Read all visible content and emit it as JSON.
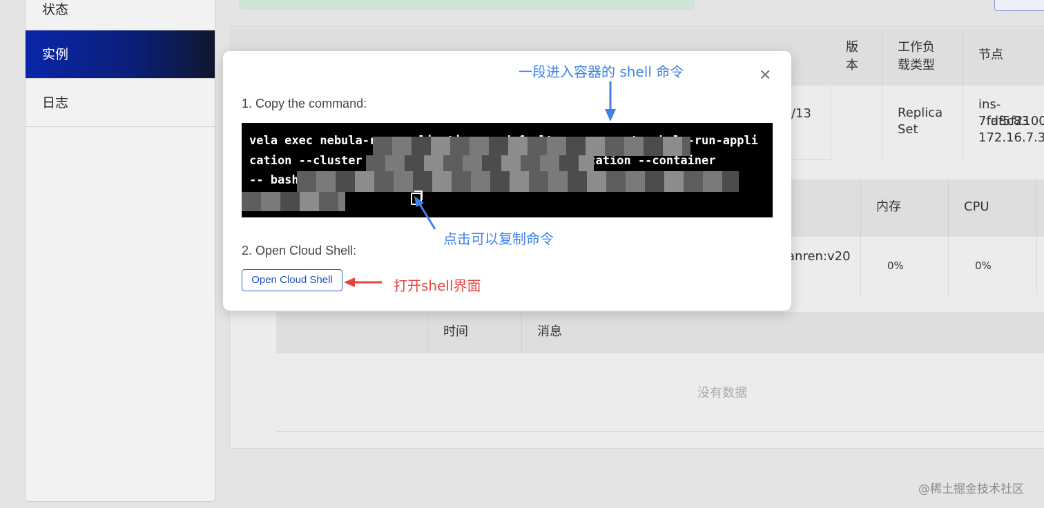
{
  "sidebar": {
    "items": [
      {
        "label": "状态"
      },
      {
        "label": "实例"
      },
      {
        "label": "日志"
      }
    ]
  },
  "table": {
    "headers": [
      "版本",
      "工作负载类型",
      "节点"
    ],
    "row": {
      "date_fragment": "/13",
      "workload_type": "Replica Set",
      "node_line1": "ins-7fd8c83",
      "node_line2": "7faf5f2100",
      "node_line3": "172.16.7.3"
    }
  },
  "container_table": {
    "headers": [
      "内存",
      "CPU"
    ],
    "image_fragment": "anren:v20",
    "memory": "0%",
    "cpu": "0%"
  },
  "events_table": {
    "headers": [
      "时间",
      "消息"
    ],
    "empty_text": "没有数据"
  },
  "modal": {
    "step1_label": "1. Copy the command:",
    "command_text": "vela exec nebula-run-application -n default --component nebula-run-application --cluster cn-lizhi --pod nebula-run-application --container\n-- bash",
    "step2_label": "2. Open Cloud Shell:",
    "open_button_label": "Open Cloud Shell",
    "close_icon": "close-icon",
    "copy_icon": "copy-icon"
  },
  "annotations": {
    "top": "一段进入容器的 shell 命令",
    "copy": "点击可以复制命令",
    "open": "打开shell界面",
    "blue_color": "#3f82e6",
    "red_color": "#e8433f"
  },
  "watermark": "@稀土掘金技术社区"
}
